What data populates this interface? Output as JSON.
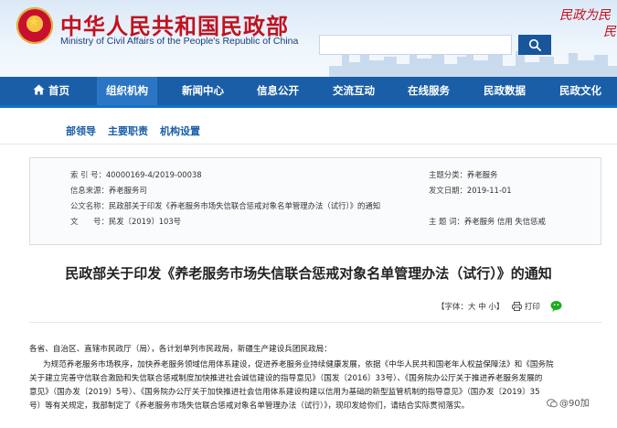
{
  "header": {
    "title": "中华人民共和国民政部",
    "subtitle": "Ministry of Civil Affairs of the People's Republic of China",
    "search_placeholder": "",
    "slogan_line1": "民政为民",
    "slogan_line2": "民"
  },
  "nav": {
    "items": [
      {
        "label": "首页"
      },
      {
        "label": "组织机构"
      },
      {
        "label": "新闻中心"
      },
      {
        "label": "信息公开"
      },
      {
        "label": "交流互动"
      },
      {
        "label": "在线服务"
      },
      {
        "label": "民政数据"
      },
      {
        "label": "民政文化"
      }
    ],
    "active_index": 1
  },
  "subnav": {
    "items": [
      {
        "label": "部领导"
      },
      {
        "label": "主要职责"
      },
      {
        "label": "机构设置"
      }
    ]
  },
  "meta": {
    "index_label": "索 引 号：",
    "index_value": "40000169-4/2019-00038",
    "source_label": "信息来源：",
    "source_value": "养老服务司",
    "subject_label": "主题分类：",
    "subject_value": "养老服务",
    "doc_name_label": "公文名称：",
    "doc_name_value": "民政部关于印发《养老服务市场失信联合惩戒对象名单管理办法（试行）》的通知",
    "date_label": "发文日期：",
    "date_value": "2019-11-01",
    "doc_no_label": "文　　号：",
    "doc_no_value": "民发〔2019〕103号",
    "topic_label": "主 题 词：",
    "topic_value": "养老服务 信用 失信惩戒"
  },
  "document": {
    "title": "民政部关于印发《养老服务市场失信联合惩戒对象名单管理办法（试行）》的通知",
    "font_size_label": "【字体：大 中 小】",
    "print_label": "打印",
    "body": {
      "salutation": "各省、自治区、直辖市民政厅（局），各计划单列市民政局，新疆生产建设兵团民政局：",
      "line1": "为规范养老服务市场秩序，加快养老服务领域信用体系建设，促进养老服务业持续健康发展，依据《中华人民共和国老年人权益保障法》和《国务院",
      "line2": "关于建立完善守信联合激励和失信联合惩戒制度加快推进社会诚信建设的指导意见》（国发〔2016〕33号）、《国务院办公厅关于推进养老服务发展的",
      "line3": "意见》（国办发〔2019〕5号）、《国务院办公厅关于加快推进社会信用体系建设构建以信用为基础的新型监管机制的指导意见》（国办发〔2019〕35",
      "line4": "号）等有关规定，我部制定了《养老服务市场失信联合惩戒对象名单管理办法（试行）》，现印发给你们，请结合实际贯彻落实。"
    }
  },
  "watermark": {
    "text": "@90加"
  },
  "colors": {
    "brand_red": "#c1121f",
    "nav_blue": "#1a5ea8",
    "link_blue": "#1a5ea8",
    "wechat_green": "#1aad19"
  }
}
